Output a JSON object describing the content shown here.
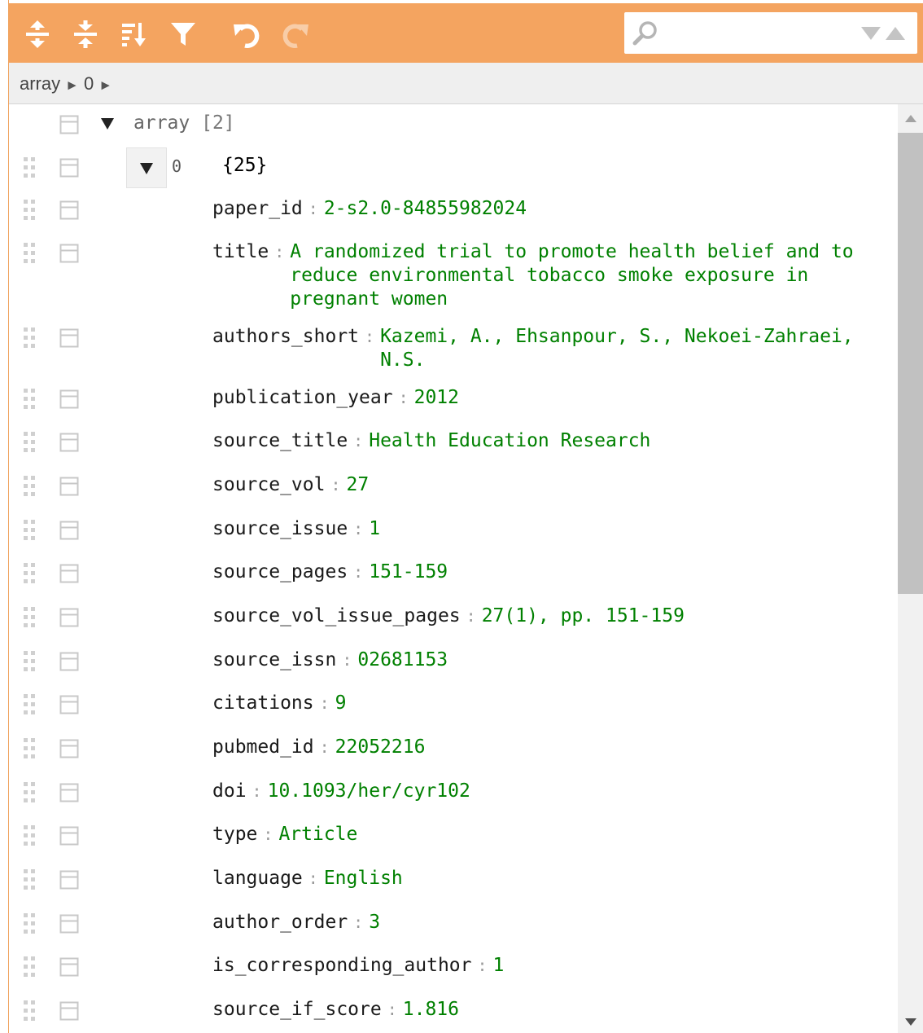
{
  "toolbar": {
    "buttons": [
      {
        "name": "expand-all-icon",
        "title": "Expand all fields"
      },
      {
        "name": "collapse-all-icon",
        "title": "Collapse all fields"
      },
      {
        "name": "sort-icon",
        "title": "Sort contents"
      },
      {
        "name": "filter-icon",
        "title": "Filter, sort, or transform contents"
      },
      {
        "name": "undo-icon",
        "title": "Undo last action"
      },
      {
        "name": "redo-icon",
        "title": "Redo"
      }
    ],
    "accent_color": "#f4a460",
    "search": {
      "value": "",
      "icons": [
        "search-icon",
        "previous-result-icon",
        "next-result-icon"
      ]
    }
  },
  "breadcrumb": {
    "items": [
      "array",
      "0"
    ],
    "separator": "►"
  },
  "tree": {
    "root": {
      "name": "array",
      "count": "[2]"
    },
    "item": {
      "index": "0",
      "count": "{25}"
    },
    "fields": [
      {
        "key": "paper_id",
        "value": "2-s2.0-84855982024"
      },
      {
        "key": "title",
        "value": "A randomized trial to promote health belief and to reduce environmental tobacco smoke exposure in pregnant women"
      },
      {
        "key": "authors_short",
        "value": "Kazemi, A., Ehsanpour, S., Nekoei-Zahraei, N.S."
      },
      {
        "key": "publication_year",
        "value": "2012"
      },
      {
        "key": "source_title",
        "value": "Health Education Research"
      },
      {
        "key": "source_vol",
        "value": "27"
      },
      {
        "key": "source_issue",
        "value": "1"
      },
      {
        "key": "source_pages",
        "value": "151-159"
      },
      {
        "key": "source_vol_issue_pages",
        "value": "27(1), pp. 151-159"
      },
      {
        "key": "source_issn",
        "value": "02681153"
      },
      {
        "key": "citations",
        "value": "9"
      },
      {
        "key": "pubmed_id",
        "value": "22052216"
      },
      {
        "key": "doi",
        "value": "10.1093/her/cyr102"
      },
      {
        "key": "type",
        "value": "Article"
      },
      {
        "key": "language",
        "value": "English"
      },
      {
        "key": "author_order",
        "value": "3"
      },
      {
        "key": "is_corresponding_author",
        "value": "1"
      },
      {
        "key": "source_if_score",
        "value": "1.816"
      }
    ],
    "value_color": "#008000"
  }
}
